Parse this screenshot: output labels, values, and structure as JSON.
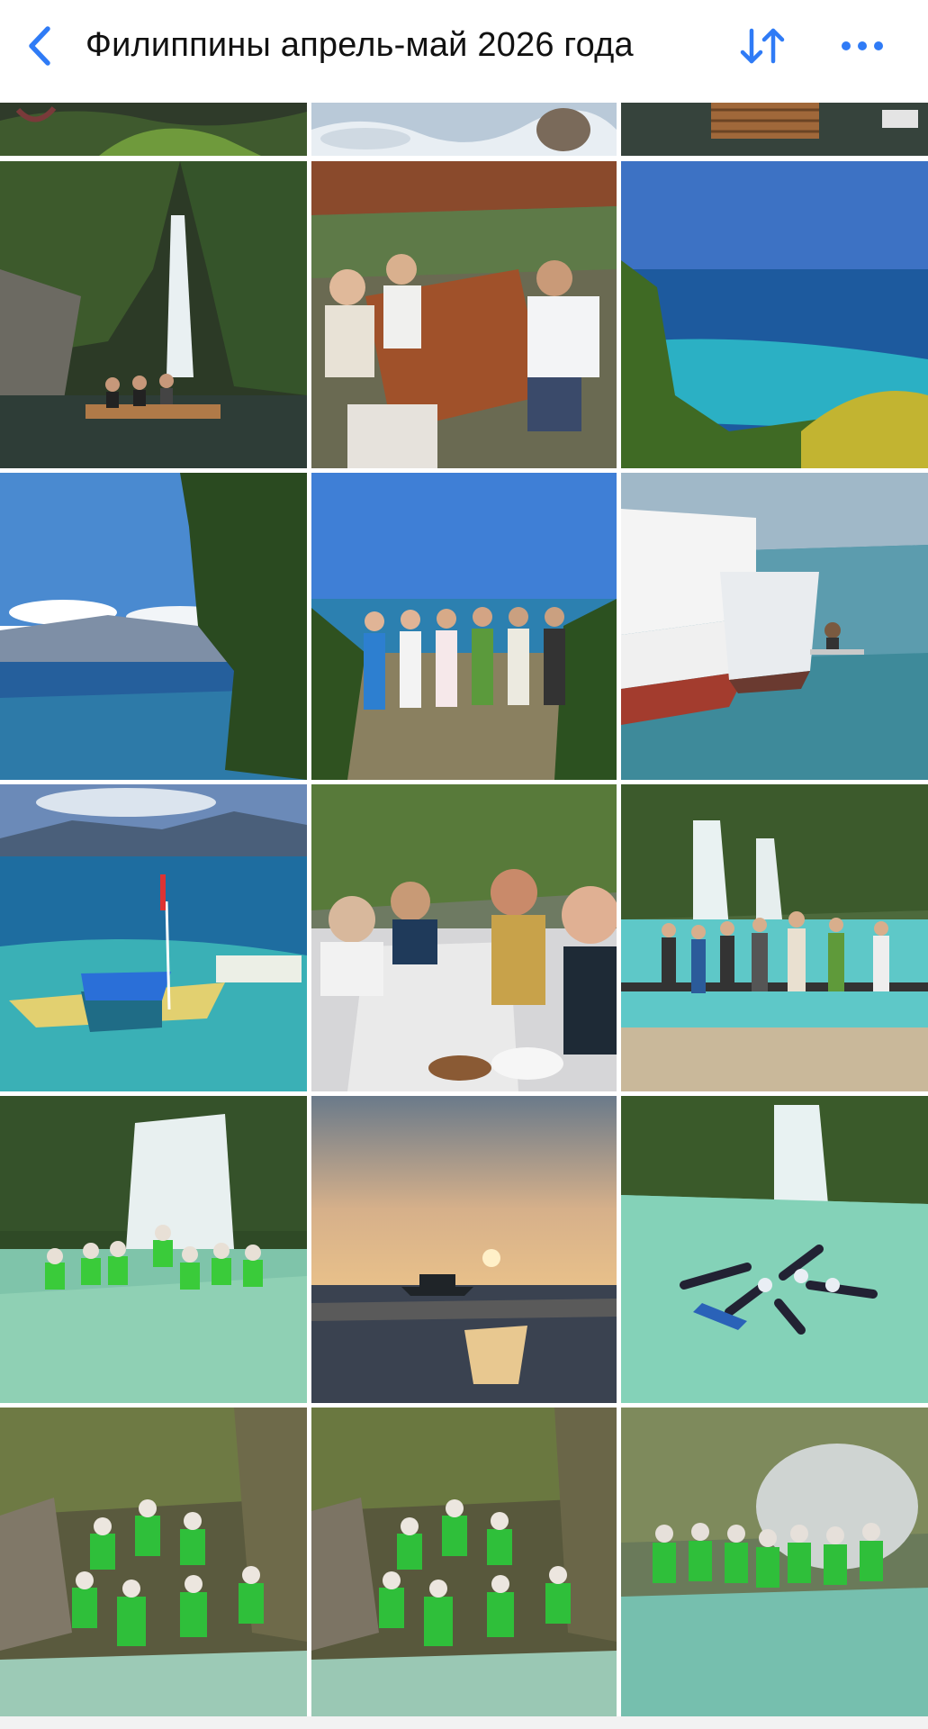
{
  "header": {
    "back_icon": "chevron-left-icon",
    "title": "Филиппины апрель-май 2026 года",
    "sort_icon": "sort-arrows-icon",
    "more_icon": "ellipsis-icon",
    "accent_color": "#2f7bf6"
  },
  "album": {
    "photos": [
      {
        "subject": "tropical garden foliage (partially visible)"
      },
      {
        "subject": "splashing water (partially visible)"
      },
      {
        "subject": "bamboo raft on water (partially visible)"
      },
      {
        "subject": "three women on a bamboo raft at a waterfall"
      },
      {
        "subject": "group dining at a restaurant table"
      },
      {
        "subject": "turquoise sea seen from a cliff"
      },
      {
        "subject": "sea and mountains under clouds"
      },
      {
        "subject": "group posing on a viewpoint above the sea"
      },
      {
        "subject": "white boats moored at the shore"
      },
      {
        "subject": "blue outrigger boat in clear water"
      },
      {
        "subject": "selfie at a dining table"
      },
      {
        "subject": "group posing at a turquoise waterfall"
      },
      {
        "subject": "group in life vests waving at a waterfall"
      },
      {
        "subject": "sunset over the sea with a boat"
      },
      {
        "subject": "people floating in a star formation"
      },
      {
        "subject": "canyoneering group in green life vests"
      },
      {
        "subject": "canyoneering group in green life vests (second shot)"
      },
      {
        "subject": "group in life vests in a river canyon"
      }
    ]
  }
}
